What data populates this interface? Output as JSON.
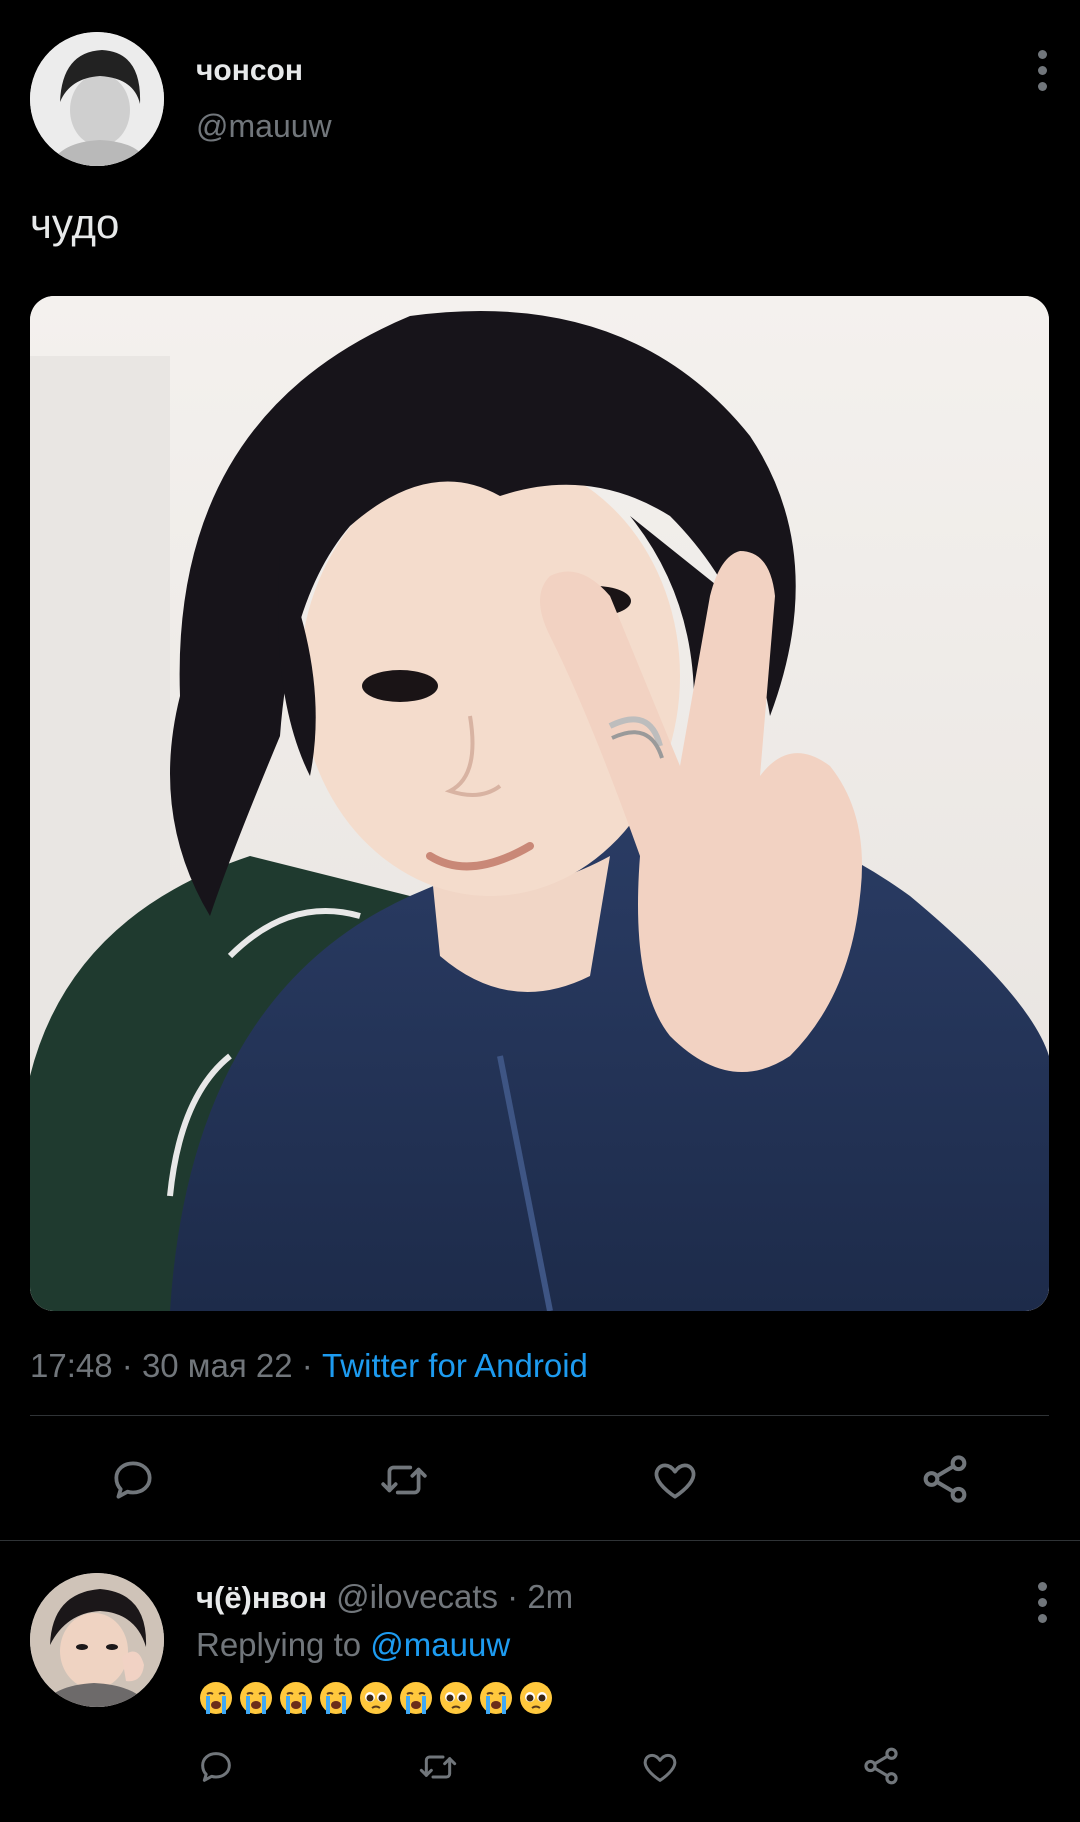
{
  "tweet": {
    "display_name": "чонсон",
    "handle": "@mauuw",
    "text": "чудо",
    "time": "17:48",
    "date": "30 мая 22",
    "source": "Twitter for Android",
    "separator": "·"
  },
  "actions": [
    "reply-icon",
    "retweet-icon",
    "like-icon",
    "share-icon"
  ],
  "reply": {
    "display_name": "ч(ё)нвон",
    "handle": "@ilovecats",
    "time_ago": "2m",
    "separator": "·",
    "replying_prefix": "Replying to",
    "replying_handle": "@mauuw",
    "emojis": [
      "loudly-crying-face",
      "loudly-crying-face",
      "loudly-crying-face",
      "loudly-crying-face",
      "pleading-face",
      "loudly-crying-face",
      "pleading-face",
      "loudly-crying-face",
      "pleading-face"
    ]
  },
  "colors": {
    "background": "#000000",
    "text": "#e7e9ea",
    "muted": "#71767b",
    "accent": "#1d9bf0",
    "divider": "#2f3336"
  }
}
